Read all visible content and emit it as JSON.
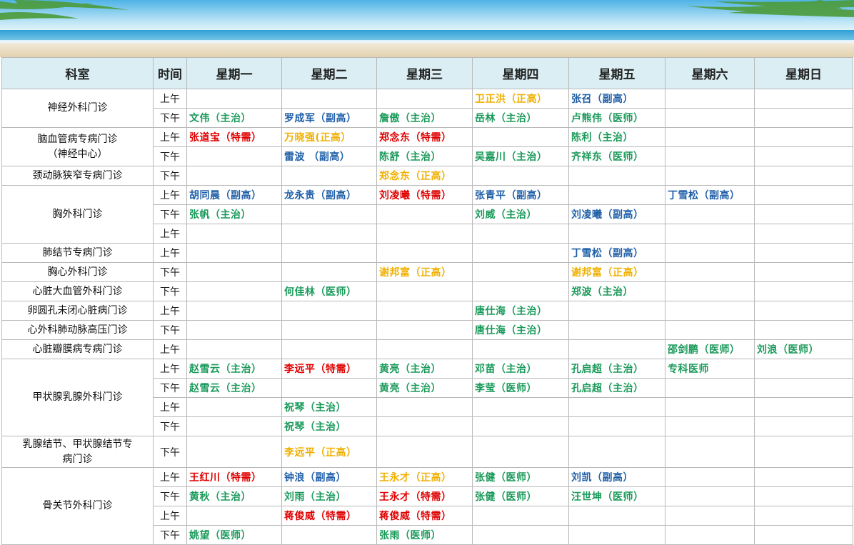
{
  "banner": {
    "description_icon": "beach-banner"
  },
  "header": [
    "科室",
    "时间",
    "星期一",
    "星期二",
    "星期三",
    "星期四",
    "星期五",
    "星期六",
    "星期日"
  ],
  "colors": {
    "green": "#1a9a5a",
    "blue": "#1f5fa8",
    "red": "#e00000",
    "orange": "#f0b000",
    "header_bg": "#daeef3"
  },
  "rows": [
    {
      "dept": "神经外科门诊",
      "span": 2,
      "time": "上午",
      "cells": [
        null,
        null,
        null,
        {
          "t": "卫正洪（正高）",
          "c": "orange"
        },
        {
          "t": "张召（副高）",
          "c": "blue"
        },
        null,
        null
      ]
    },
    {
      "time": "下午",
      "cells": [
        {
          "t": "文伟（主治）",
          "c": "green"
        },
        {
          "t": "罗成军（副高）",
          "c": "blue"
        },
        {
          "t": "詹傲（主治）",
          "c": "green"
        },
        {
          "t": "岳林（主治）",
          "c": "green"
        },
        {
          "t": "卢熊伟（医师）",
          "c": "green"
        },
        null,
        null
      ]
    },
    {
      "dept": "脑血管病专病门诊\n（神经中心）",
      "span": 2,
      "time": "上午",
      "cells": [
        {
          "t": "张道宝（特需）",
          "c": "red"
        },
        {
          "t": "万晓强(正高）",
          "c": "orange"
        },
        {
          "t": "郑念东（特需）",
          "c": "red"
        },
        null,
        {
          "t": "陈利（主治）",
          "c": "green"
        },
        null,
        null
      ]
    },
    {
      "time": "下午",
      "cells": [
        null,
        {
          "t": "雷波 （副高）",
          "c": "blue"
        },
        {
          "t": "陈舒（主治）",
          "c": "green"
        },
        {
          "t": "吴嘉川（主治）",
          "c": "green"
        },
        {
          "t": "齐祥东（医师）",
          "c": "green"
        },
        null,
        null
      ]
    },
    {
      "dept": "颈动脉狭窄专病门诊",
      "span": 1,
      "time": "下午",
      "cells": [
        null,
        null,
        {
          "t": "郑念东（正高）",
          "c": "orange"
        },
        null,
        null,
        null,
        null
      ]
    },
    {
      "dept": "胸外科门诊",
      "span": 3,
      "time": "上午",
      "cells": [
        {
          "t": "胡同晨（副高）",
          "c": "blue"
        },
        {
          "t": "龙永贵（副高）",
          "c": "blue"
        },
        {
          "t": "刘凌曦（特需）",
          "c": "red"
        },
        {
          "t": "张青平（副高）",
          "c": "blue"
        },
        null,
        {
          "t": "丁雪松（副高）",
          "c": "blue"
        },
        null
      ]
    },
    {
      "time": "下午",
      "cells": [
        {
          "t": "张帆（主治）",
          "c": "green"
        },
        null,
        null,
        {
          "t": "刘威（主治）",
          "c": "green"
        },
        {
          "t": "刘凌曦（副高）",
          "c": "blue"
        },
        null,
        null
      ]
    },
    {
      "time": "上午",
      "cells": [
        null,
        null,
        null,
        null,
        null,
        null,
        null
      ]
    },
    {
      "dept": "肺结节专病门诊",
      "span": 1,
      "time": "上午",
      "cells": [
        null,
        null,
        null,
        null,
        {
          "t": "丁雪松（副高）",
          "c": "blue"
        },
        null,
        null
      ]
    },
    {
      "dept": "胸心外科门诊",
      "span": 1,
      "time": "下午",
      "cells": [
        null,
        null,
        {
          "t": "谢邦富（正高）",
          "c": "orange"
        },
        null,
        {
          "t": "谢邦富（正高）",
          "c": "orange"
        },
        null,
        null
      ]
    },
    {
      "dept": "心脏大血管外科门诊",
      "span": 1,
      "time": "下午",
      "cells": [
        null,
        {
          "t": "何佳林（医师）",
          "c": "green"
        },
        null,
        null,
        {
          "t": "郑波（主治）",
          "c": "green"
        },
        null,
        null
      ]
    },
    {
      "dept": "卵圆孔未闭心脏病门诊",
      "span": 1,
      "time": "上午",
      "cells": [
        null,
        null,
        null,
        {
          "t": "唐仕海（主治）",
          "c": "green"
        },
        null,
        null,
        null
      ]
    },
    {
      "dept": "心外科肺动脉高压门诊",
      "span": 1,
      "time": "下午",
      "cells": [
        null,
        null,
        null,
        {
          "t": "唐仕海（主治）",
          "c": "green"
        },
        null,
        null,
        null
      ]
    },
    {
      "dept": "心脏瓣膜病专病门诊",
      "span": 1,
      "time": "上午",
      "cells": [
        null,
        null,
        null,
        null,
        null,
        {
          "t": "邵剑鹏（医师）",
          "c": "green"
        },
        {
          "t": "刘浪（医师）",
          "c": "green"
        }
      ]
    },
    {
      "dept": "甲状腺乳腺外科门诊",
      "span": 4,
      "time": "上午",
      "cells": [
        {
          "t": "赵雪云（主治）",
          "c": "green"
        },
        {
          "t": "李远平（特需）",
          "c": "red"
        },
        {
          "t": "黄亮（主治）",
          "c": "green"
        },
        {
          "t": "邓苗（主治）",
          "c": "green"
        },
        {
          "t": "孔启超（主治）",
          "c": "green"
        },
        {
          "t": "专科医师",
          "c": "green"
        },
        null
      ]
    },
    {
      "time": "下午",
      "cells": [
        {
          "t": "赵雪云（主治）",
          "c": "green"
        },
        null,
        {
          "t": "黄亮（主治）",
          "c": "green"
        },
        {
          "t": "李莹（医师）",
          "c": "green"
        },
        {
          "t": "孔启超（主治）",
          "c": "green"
        },
        null,
        null
      ]
    },
    {
      "time": "上午",
      "cells": [
        null,
        {
          "t": "祝琴（主治）",
          "c": "green"
        },
        null,
        null,
        null,
        null,
        null
      ]
    },
    {
      "time": "下午",
      "cells": [
        null,
        {
          "t": "祝琴（主治）",
          "c": "green"
        },
        null,
        null,
        null,
        null,
        null
      ]
    },
    {
      "dept": "乳腺结节、甲状腺结节专\n病门诊",
      "span": 1,
      "tall": true,
      "time": "下午",
      "cells": [
        null,
        {
          "t": "李远平（正高）",
          "c": "orange"
        },
        null,
        null,
        null,
        null,
        null
      ]
    },
    {
      "dept": "骨关节外科门诊",
      "span": 4,
      "time": "上午",
      "cells": [
        {
          "t": "王红川（特需）",
          "c": "red"
        },
        {
          "t": "钟浪（副高）",
          "c": "blue"
        },
        {
          "t": "王永才（正高）",
          "c": "orange"
        },
        {
          "t": "张健（医师）",
          "c": "green"
        },
        {
          "t": "刘凯（副高）",
          "c": "blue"
        },
        null,
        null
      ]
    },
    {
      "time": "下午",
      "cells": [
        {
          "t": "黄秋（主治）",
          "c": "green"
        },
        {
          "t": "刘雨（主治）",
          "c": "green"
        },
        {
          "t": "王永才（特需）",
          "c": "red"
        },
        {
          "t": "张健（医师）",
          "c": "green"
        },
        {
          "t": "汪世坤（医师）",
          "c": "green"
        },
        null,
        null
      ]
    },
    {
      "time": "上午",
      "cells": [
        null,
        {
          "t": "蒋俊威（特需）",
          "c": "red"
        },
        {
          "t": "蒋俊威（特需）",
          "c": "red"
        },
        null,
        null,
        null,
        null
      ]
    },
    {
      "time": "下午",
      "cells": [
        {
          "t": "姚望（医师）",
          "c": "green"
        },
        null,
        {
          "t": "张雨（医师）",
          "c": "green"
        },
        null,
        null,
        null,
        null
      ]
    }
  ]
}
